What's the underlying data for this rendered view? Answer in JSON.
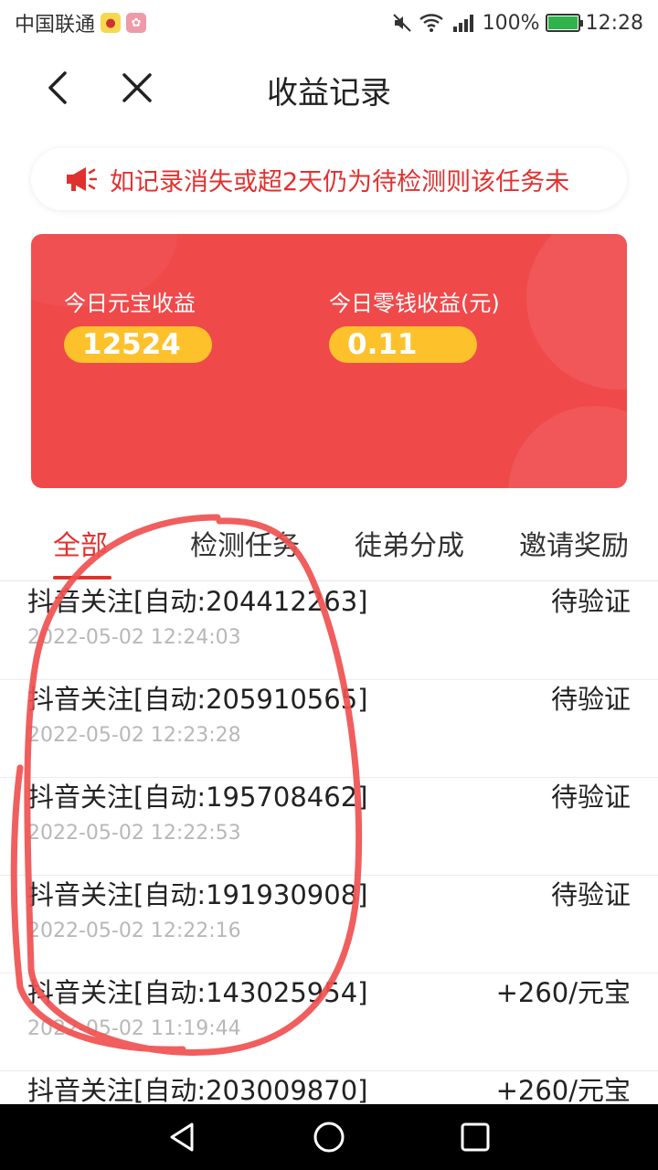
{
  "status_bar": {
    "carrier": "中国联通",
    "battery": "100%",
    "time": "12:28"
  },
  "header": {
    "title": "收益记录"
  },
  "notice": {
    "text": "如记录消失或超2天仍为待检测则该任务未"
  },
  "card": {
    "yuanbao_label": "今日元宝收益",
    "yuanbao_value": "12524",
    "change_label": "今日零钱收益(元)",
    "change_value": "0.11"
  },
  "tabs": [
    {
      "label": "全部",
      "active": true
    },
    {
      "label": "检测任务",
      "active": false
    },
    {
      "label": "徒弟分成",
      "active": false
    },
    {
      "label": "邀请奖励",
      "active": false
    }
  ],
  "records": [
    {
      "title": "抖音关注[自动:204412263]",
      "time": "2022-05-02 12:24:03",
      "status": "待验证"
    },
    {
      "title": "抖音关注[自动:205910565]",
      "time": "2022-05-02 12:23:28",
      "status": "待验证"
    },
    {
      "title": "抖音关注[自动:195708462]",
      "time": "2022-05-02 12:22:53",
      "status": "待验证"
    },
    {
      "title": "抖音关注[自动:191930908]",
      "time": "2022-05-02 12:22:16",
      "status": "待验证"
    },
    {
      "title": "抖音关注[自动:143025954]",
      "time": "2022-05-02 11:19:44",
      "status": "+260/元宝"
    },
    {
      "title": "抖音关注[自动:203009870]",
      "time": "",
      "status": "+260/元宝"
    }
  ],
  "colors": {
    "accent_red": "#e0312f",
    "card_red": "#f0494a",
    "pill_yellow": "#fdc12c",
    "annotation": "#f05050"
  }
}
